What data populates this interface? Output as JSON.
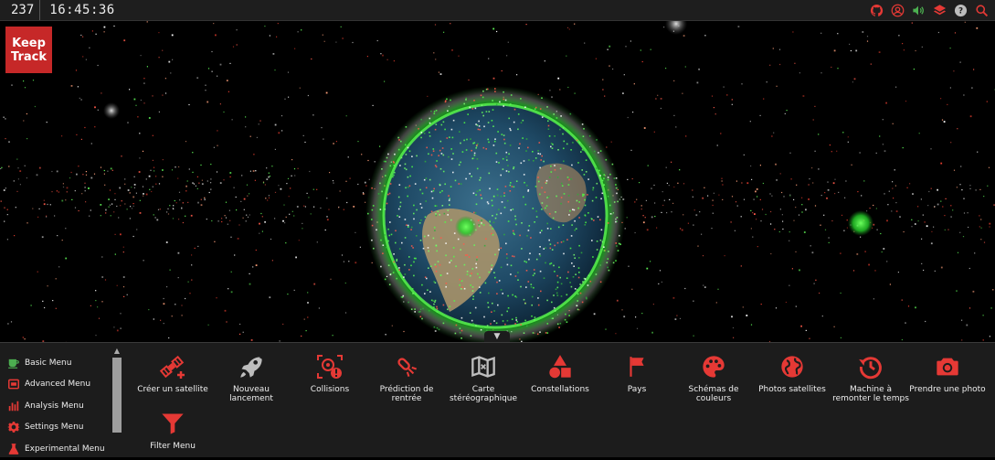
{
  "topbar": {
    "fps": "237",
    "clock": "16:45:36",
    "icons": [
      "github-icon",
      "user-account-icon",
      "sound-on-icon",
      "layers-icon",
      "help-icon",
      "search-icon"
    ]
  },
  "logo": {
    "line1": "Keep",
    "line2": "Track"
  },
  "colors": {
    "accent": "#e53935",
    "logo_bg": "#c62828",
    "menu_bg": "#1c1c1c",
    "topbar_bg": "#1e1e1e",
    "sound_green": "#4caf50"
  },
  "side_menu": [
    {
      "label": "Basic Menu",
      "icon": "coffee-cup-icon",
      "color": "#4caf50"
    },
    {
      "label": "Advanced Menu",
      "icon": "advanced-icon",
      "color": "#e53935"
    },
    {
      "label": "Analysis Menu",
      "icon": "bar-chart-icon",
      "color": "#e53935"
    },
    {
      "label": "Settings Menu",
      "icon": "gear-icon",
      "color": "#e53935"
    },
    {
      "label": "Experimental Menu",
      "icon": "flask-icon",
      "color": "#e53935"
    }
  ],
  "menu_items": [
    {
      "label": "Créer un satellite",
      "icon": "satellite-add-icon"
    },
    {
      "label": "Nouveau lancement",
      "icon": "rocket-icon"
    },
    {
      "label": "Collisions",
      "icon": "collision-icon"
    },
    {
      "label": "Prédiction de rentrée",
      "icon": "reentry-icon"
    },
    {
      "label": "Carte stéréographique",
      "icon": "map-icon"
    },
    {
      "label": "Constellations",
      "icon": "shapes-icon"
    },
    {
      "label": "Pays",
      "icon": "flag-icon"
    },
    {
      "label": "Schémas de couleurs",
      "icon": "palette-icon"
    },
    {
      "label": "Photos satellites",
      "icon": "globe-icon"
    },
    {
      "label": "Machine à remonter le temps",
      "icon": "history-icon"
    },
    {
      "label": "Prendre une photo",
      "icon": "camera-icon"
    },
    {
      "label": "Filter Menu",
      "icon": "filter-icon"
    }
  ]
}
